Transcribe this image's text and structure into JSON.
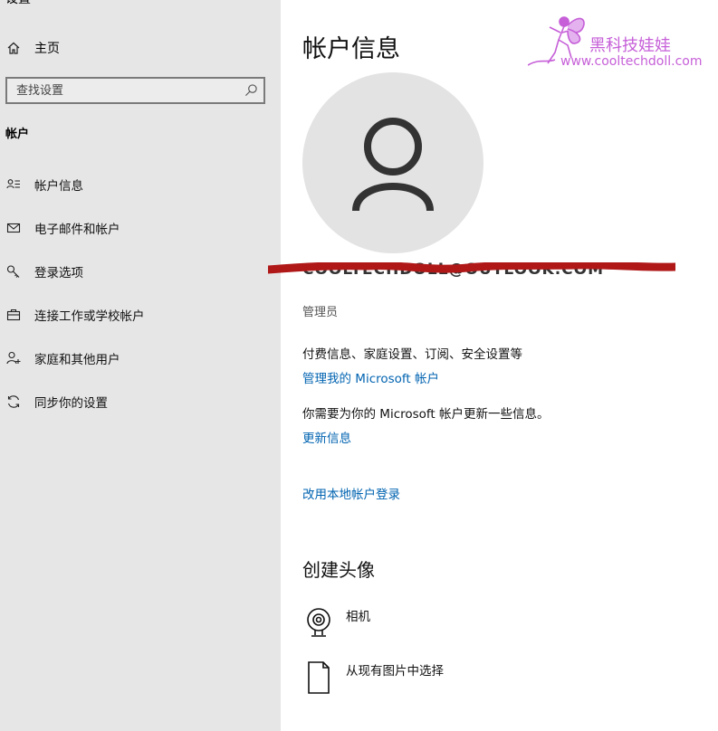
{
  "window": {
    "title_fragment": "设置"
  },
  "sidebar": {
    "home_label": "主页",
    "search_placeholder": "查找设置",
    "section_title": "帐户",
    "items": [
      {
        "label": "帐户信息",
        "icon": "account-info-icon"
      },
      {
        "label": "电子邮件和帐户",
        "icon": "mail-icon"
      },
      {
        "label": "登录选项",
        "icon": "key-icon"
      },
      {
        "label": "连接工作或学校帐户",
        "icon": "briefcase-icon"
      },
      {
        "label": "家庭和其他用户",
        "icon": "add-person-icon"
      },
      {
        "label": "同步你的设置",
        "icon": "sync-icon"
      }
    ]
  },
  "main": {
    "title": "帐户信息",
    "email": "COOLTECHDOLL@OUTLOOK.COM",
    "role": "管理员",
    "billing_text": "付费信息、家庭设置、订阅、安全设置等",
    "manage_link": "管理我的 Microsoft 帐户",
    "update_notice": "你需要为你的 Microsoft 帐户更新一些信息。",
    "update_link": "更新信息",
    "local_link": "改用本地帐户登录",
    "create_heading": "创建头像",
    "camera_label": "相机",
    "browse_label": "从现有图片中选择"
  },
  "watermark": {
    "title": "黑科技娃娃",
    "url": "www.cooltechdoll.com"
  },
  "colors": {
    "sidebar_bg": "#e6e6e6",
    "link": "#0063b1",
    "avatar_bg": "#e3e3e3",
    "redaction": "#b01818",
    "watermark": "#c65fd8"
  }
}
